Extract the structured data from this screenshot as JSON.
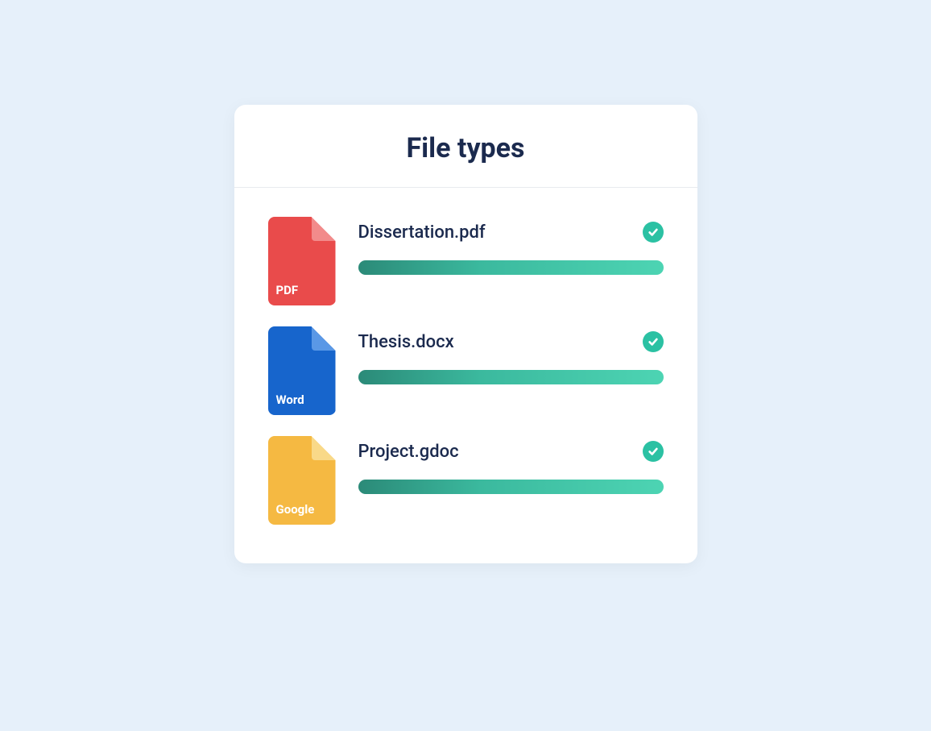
{
  "card": {
    "title": "File types",
    "files": [
      {
        "icon_label": "PDF",
        "icon_class": "file-pdf",
        "name": "Dissertation.pdf",
        "status": "complete",
        "progress": 100
      },
      {
        "icon_label": "Word",
        "icon_class": "file-word",
        "name": "Thesis.docx",
        "status": "complete",
        "progress": 100
      },
      {
        "icon_label": "Google",
        "icon_class": "file-google",
        "name": "Project.gdoc",
        "status": "complete",
        "progress": 100
      }
    ]
  },
  "colors": {
    "background": "#e6f0fa",
    "card_bg": "#ffffff",
    "heading": "#1b2a4e",
    "accent": "#2bc1a3",
    "pdf": "#e94b4b",
    "word": "#1765cc",
    "google": "#f5b942"
  }
}
